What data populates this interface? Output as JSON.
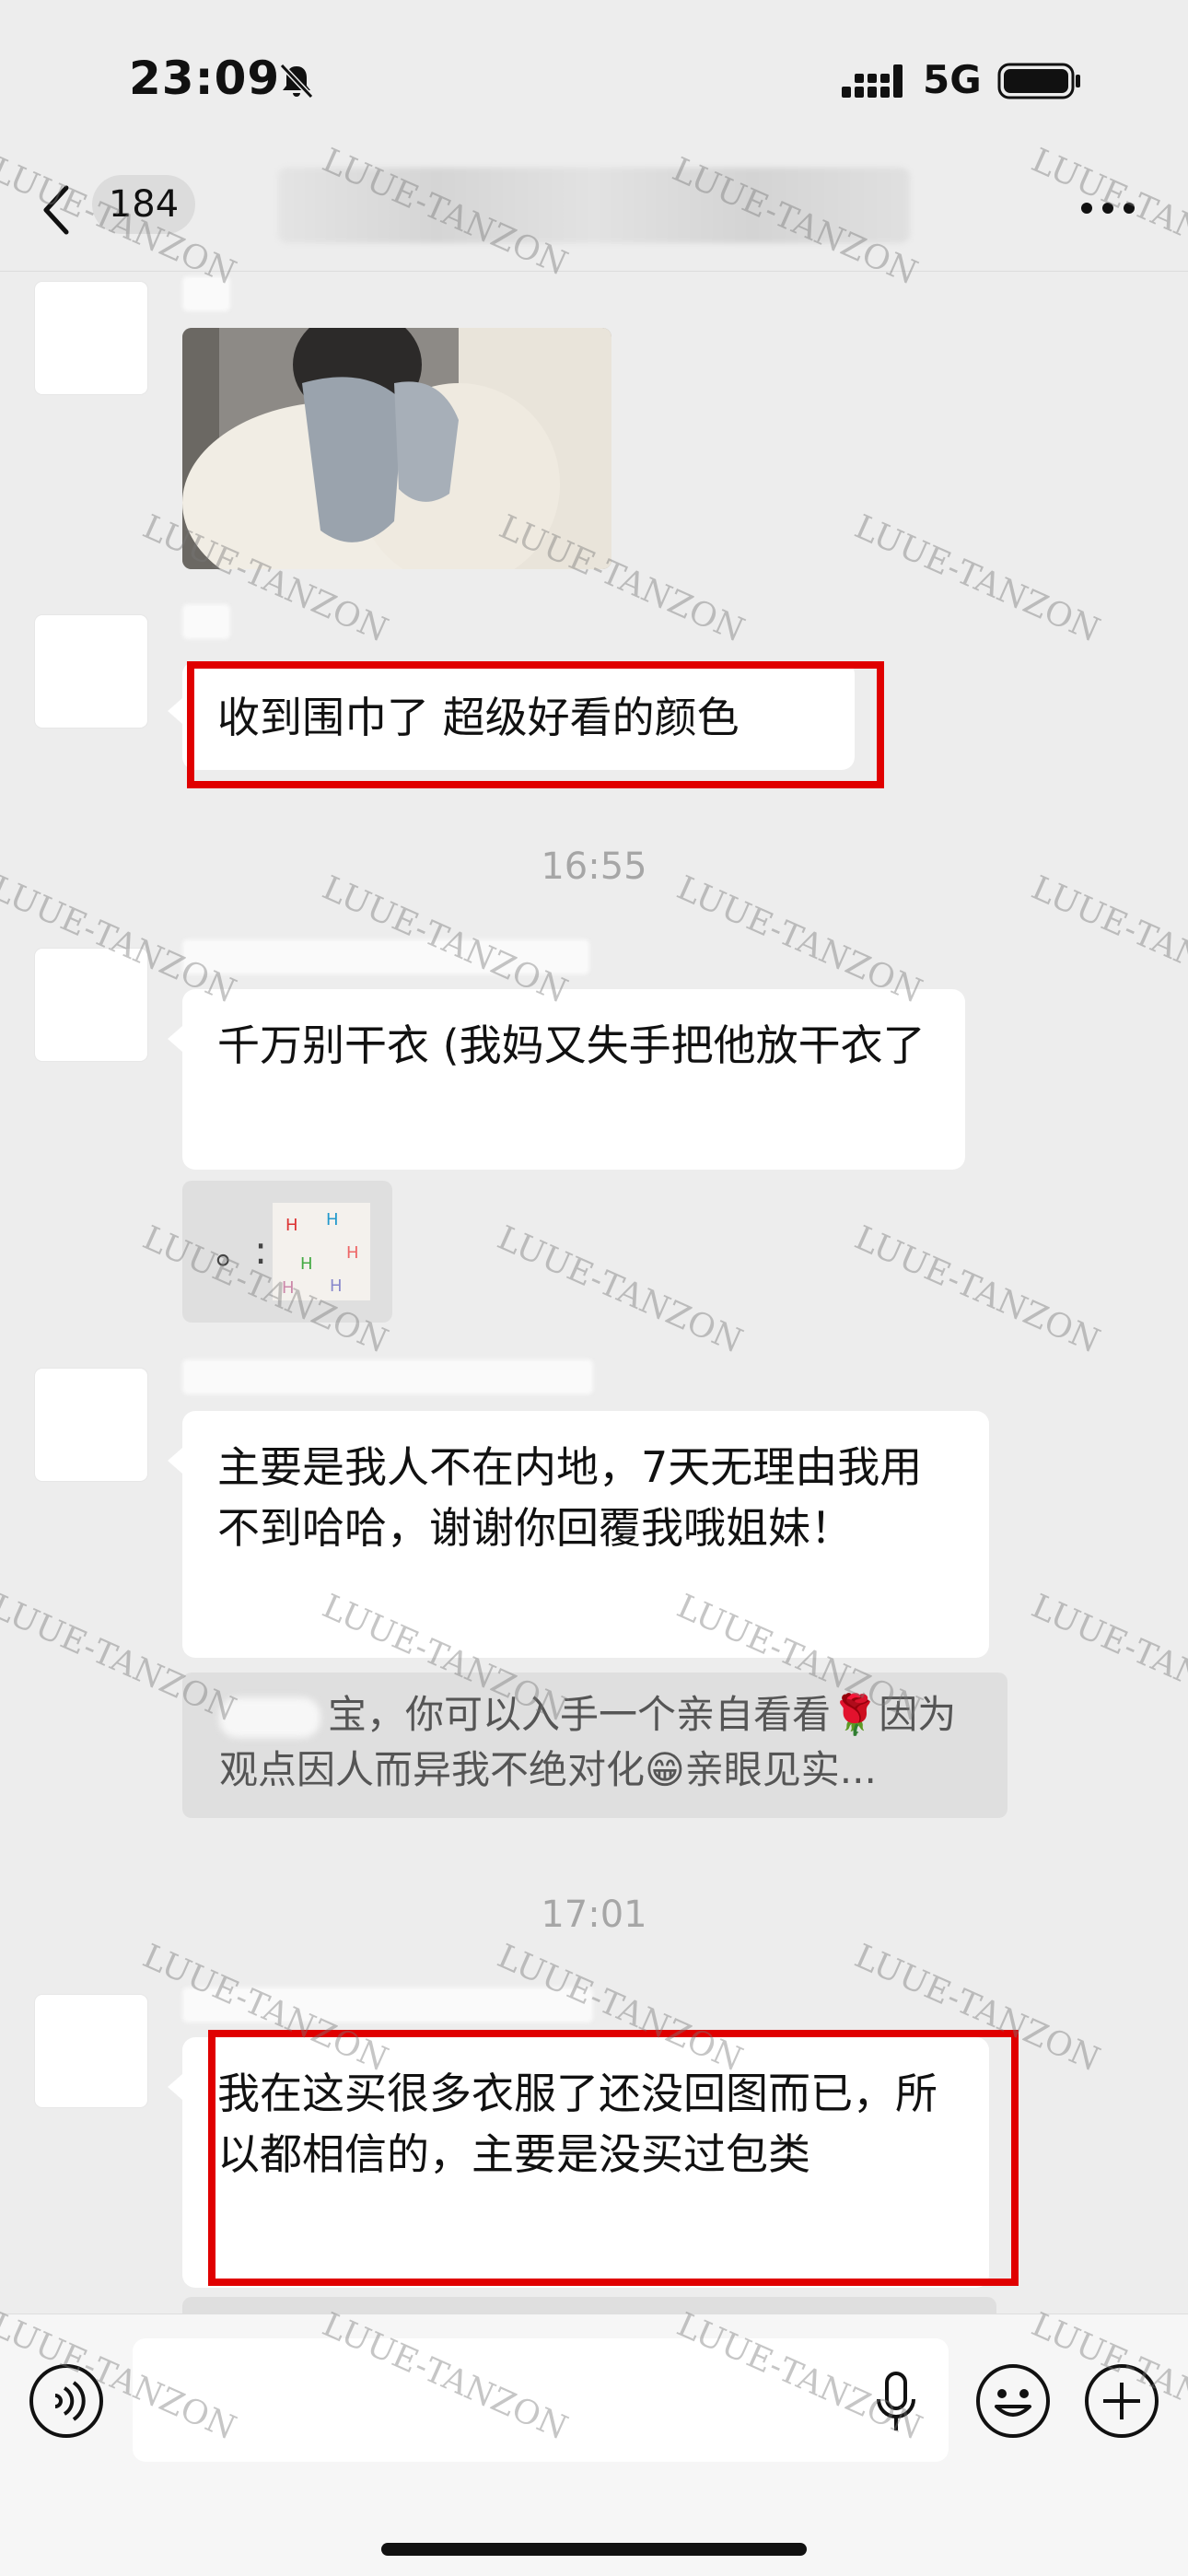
{
  "status_bar": {
    "time": "23:09",
    "network": "5G"
  },
  "nav": {
    "unread_count": "184"
  },
  "messages": [
    {
      "text": "收到围巾了 超级好看的颜色"
    },
    {
      "text": "千万别干衣 (我妈又失手把他放干衣了"
    },
    {
      "image_caption": "。:"
    },
    {
      "text": "主要是我人不在内地，7天无理由我用不到哈哈，谢谢你回覆我哦姐妹！"
    },
    {
      "text": "我在这买很多衣服了还没回图而已，所以都相信的，主要是没买过包类"
    }
  ],
  "quote": {
    "text": "宝，你可以入手一个亲自看看🌹因为观点因人而异我不绝对化😁亲眼见实..."
  },
  "timestamps": [
    "16:55",
    "17:01"
  ],
  "watermark": "LUUE-TANZON",
  "colors": {
    "highlight": "#e00000",
    "bubble": "#ffffff",
    "background": "#ededed"
  },
  "icons": [
    "bell-slash-icon",
    "signal-icon",
    "battery-icon",
    "back-chevron-icon",
    "more-icon",
    "voice-icon",
    "mic-icon",
    "emoji-icon",
    "plus-icon"
  ]
}
